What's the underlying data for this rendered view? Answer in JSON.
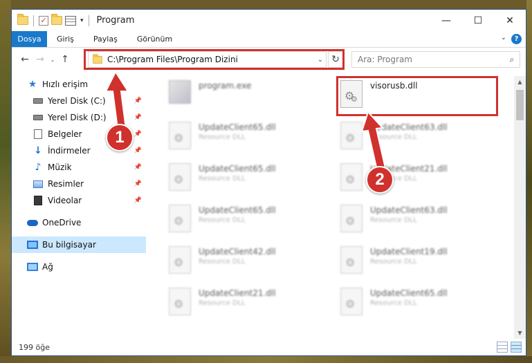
{
  "window": {
    "title": "Program"
  },
  "caption": {
    "minimize": "—",
    "maximize": "☐",
    "close": "✕"
  },
  "ribbon": {
    "tabs": [
      {
        "label": "Dosya"
      },
      {
        "label": "Giriş"
      },
      {
        "label": "Paylaş"
      },
      {
        "label": "Görünüm"
      }
    ],
    "help": "?"
  },
  "navigation": {
    "back": "←",
    "forward": "→",
    "recent": "⌄",
    "up": "↑",
    "address": "C:\\Program Files\\Program Dizini",
    "search_placeholder": "Ara: Program"
  },
  "sidebar": {
    "items": [
      {
        "label": "Hızlı erişim",
        "icon": "star-icon"
      },
      {
        "label": "Yerel Disk (C:)",
        "icon": "drive-icon",
        "pinned": true
      },
      {
        "label": "Yerel Disk (D:)",
        "icon": "drive-icon",
        "pinned": true
      },
      {
        "label": "Belgeler",
        "icon": "documents-icon",
        "pinned": true
      },
      {
        "label": "İndirmeler",
        "icon": "downloads-icon",
        "pinned": true
      },
      {
        "label": "Müzik",
        "icon": "music-icon",
        "pinned": true
      },
      {
        "label": "Resimler",
        "icon": "pictures-icon",
        "pinned": true
      },
      {
        "label": "Videolar",
        "icon": "videos-icon",
        "pinned": true
      },
      {
        "label": "OneDrive",
        "icon": "onedrive-icon"
      },
      {
        "label": "Bu bilgisayar",
        "icon": "this-pc-icon",
        "selected": true
      },
      {
        "label": "Ağ",
        "icon": "network-icon"
      }
    ]
  },
  "files": [
    {
      "name": "program.exe",
      "desc": "",
      "type": "exe",
      "blurred": true
    },
    {
      "name": "visorusb.dll",
      "desc": "",
      "type": "dll",
      "blurred": false,
      "highlighted": true
    },
    {
      "name": "UpdateClient65.dll",
      "desc": "Resource DLL",
      "type": "dll",
      "blurred": true
    },
    {
      "name": "UpdateClient63.dll",
      "desc": "Resource DLL",
      "type": "dll",
      "blurred": true
    },
    {
      "name": "UpdateClient65.dll",
      "desc": "Resource DLL",
      "type": "dll",
      "blurred": true
    },
    {
      "name": "UpdateClient21.dll",
      "desc": "Resource DLL",
      "type": "dll",
      "blurred": true
    },
    {
      "name": "UpdateClient65.dll",
      "desc": "Resource DLL",
      "type": "dll",
      "blurred": true
    },
    {
      "name": "UpdateClient63.dll",
      "desc": "Resource DLL",
      "type": "dll",
      "blurred": true
    },
    {
      "name": "UpdateClient42.dll",
      "desc": "Resource DLL",
      "type": "dll",
      "blurred": true
    },
    {
      "name": "UpdateClient19.dll",
      "desc": "Resource DLL",
      "type": "dll",
      "blurred": true
    },
    {
      "name": "UpdateClient21.dll",
      "desc": "Resource DLL",
      "type": "dll",
      "blurred": true
    },
    {
      "name": "UpdateClient65.dll",
      "desc": "Resource DLL",
      "type": "dll",
      "blurred": true
    }
  ],
  "status": {
    "item_count": "199 öğe"
  },
  "annotations": {
    "step1": "1",
    "step2": "2",
    "color": "#d0312d"
  }
}
